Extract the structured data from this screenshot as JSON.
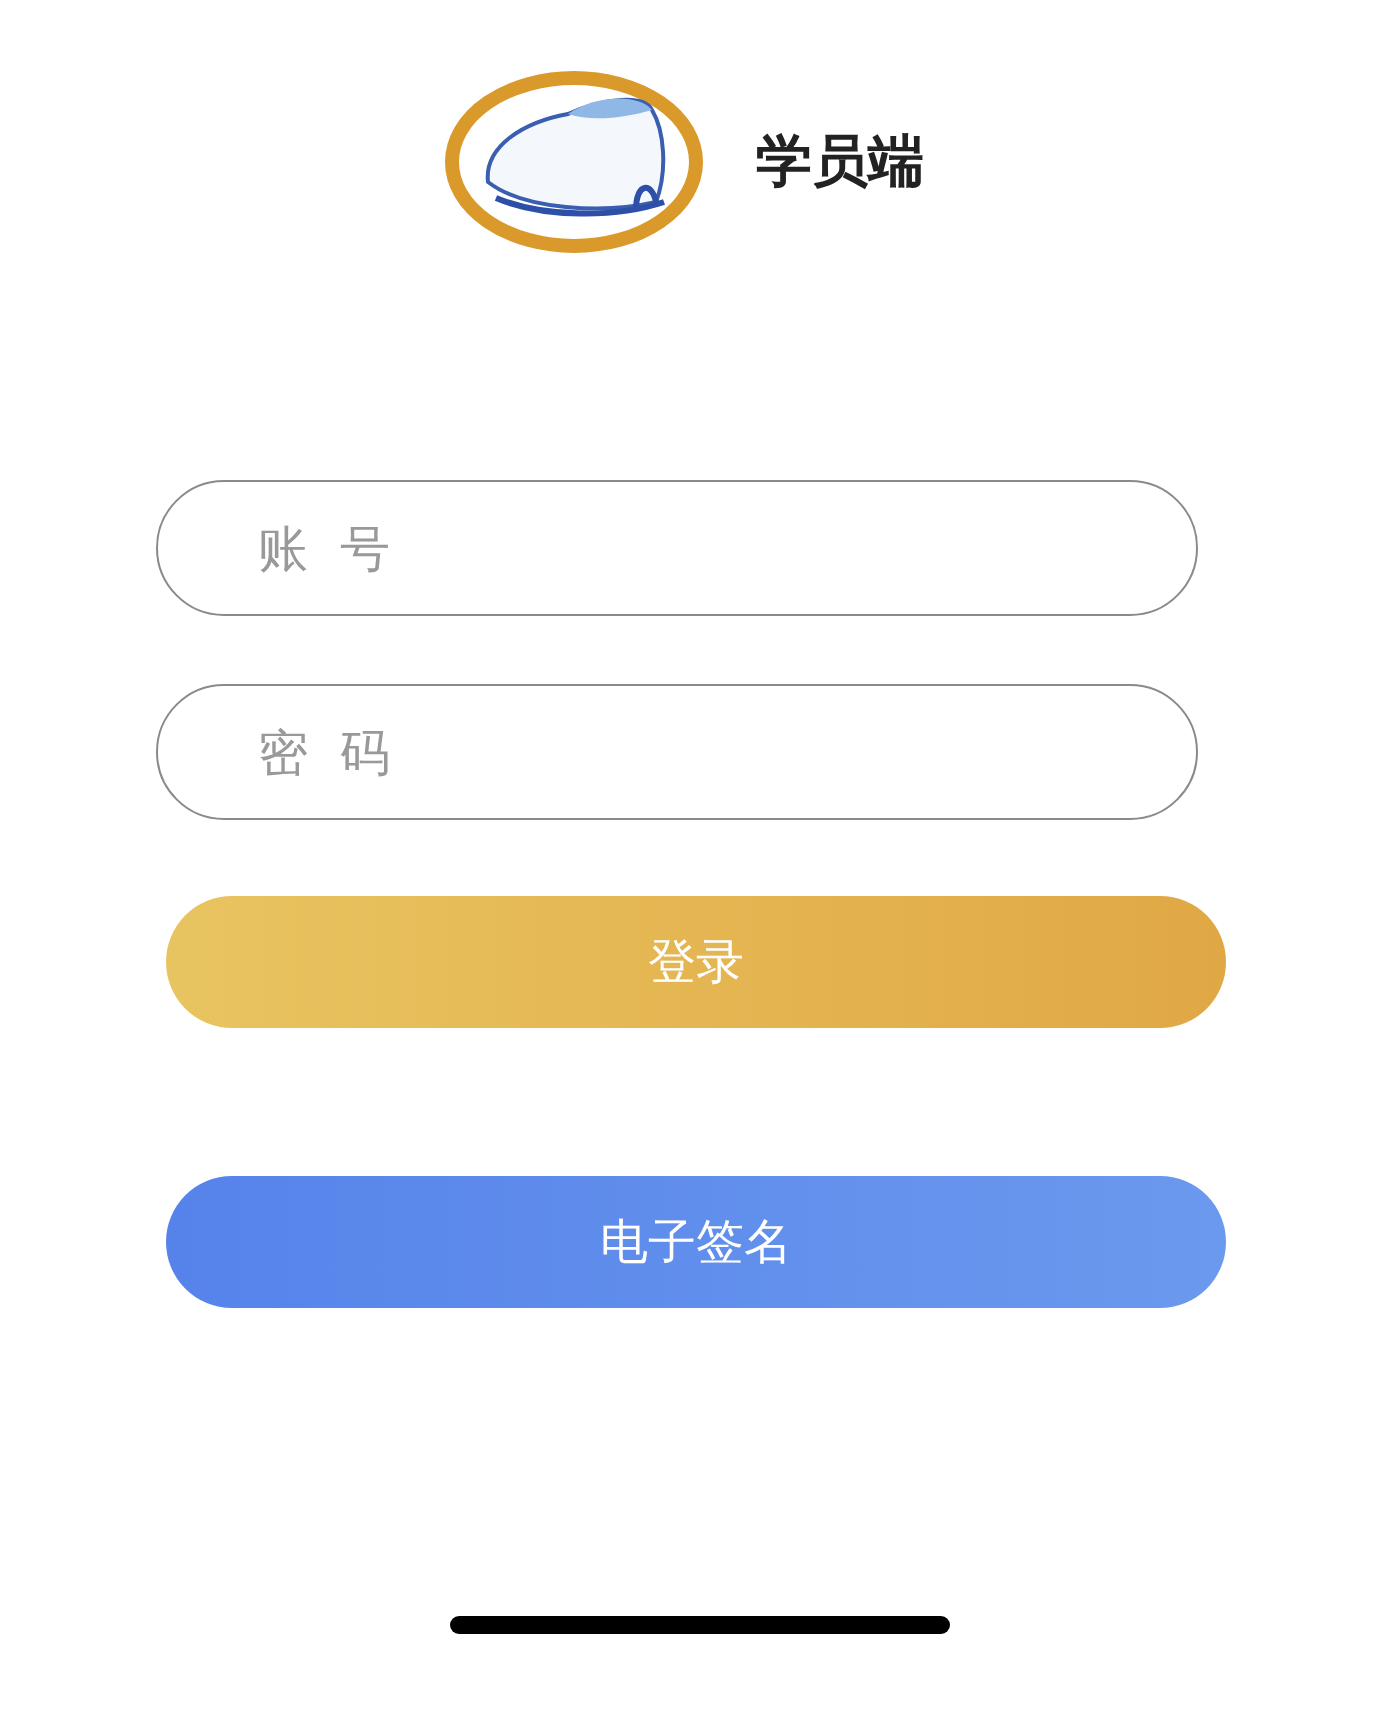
{
  "header": {
    "title": "学员端"
  },
  "fields": [
    {
      "placeholder": "账 号"
    },
    {
      "placeholder": "密 码"
    }
  ],
  "buttons": [
    {
      "kind": "primary",
      "label": "登录"
    },
    {
      "kind": "secondary",
      "label": "电子签名"
    }
  ]
}
